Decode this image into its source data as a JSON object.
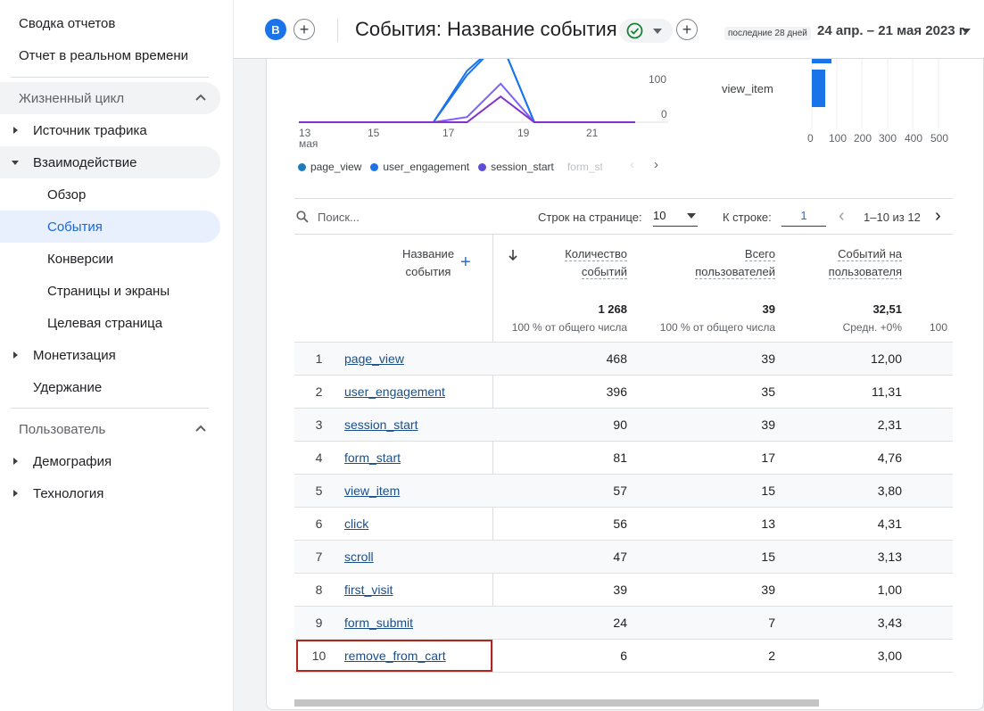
{
  "sidebar": {
    "top_links": [
      "Сводка отчетов",
      "Отчет в реальном времени"
    ],
    "sections": [
      {
        "label": "Жизненный цикл",
        "items": [
          {
            "label": "Источник трафика",
            "expandable": true,
            "expanded": false
          },
          {
            "label": "Взаимодействие",
            "expandable": true,
            "expanded": true
          },
          {
            "label": "Обзор",
            "sub": true
          },
          {
            "label": "События",
            "sub": true,
            "active": true
          },
          {
            "label": "Конверсии",
            "sub": true
          },
          {
            "label": "Страницы и экраны",
            "sub": true
          },
          {
            "label": "Целевая страница",
            "sub": true
          },
          {
            "label": "Монетизация",
            "expandable": true,
            "expanded": false
          },
          {
            "label": "Удержание",
            "expandable": false
          }
        ]
      },
      {
        "label": "Пользователь",
        "items": [
          {
            "label": "Демография",
            "expandable": true,
            "expanded": false
          },
          {
            "label": "Технология",
            "expandable": true,
            "expanded": false
          }
        ]
      }
    ]
  },
  "header": {
    "avatar_letter": "B",
    "title": "События: Название события",
    "date_label": "последние 28 дней",
    "date_range": "24 апр. – 21 мая 2023 г."
  },
  "chart_data": [
    {
      "type": "line",
      "x_ticks": [
        "13\nмая",
        "15",
        "17",
        "19",
        "21"
      ],
      "x_tick_labels": [
        "13",
        "15",
        "17",
        "19",
        "21"
      ],
      "x_tick_sublabel": "мая",
      "y_ticks": [
        "100",
        "0"
      ],
      "series": [
        {
          "name": "page_view",
          "color": "#1a73e8",
          "values": [
            0,
            0,
            0,
            0,
            0,
            120,
            340,
            0,
            0,
            0,
            0
          ]
        },
        {
          "name": "user_engagement",
          "color": "#1a73e8",
          "values": [
            0,
            0,
            0,
            0,
            0,
            110,
            310,
            0,
            0,
            0,
            0
          ]
        },
        {
          "name": "session_start",
          "color": "#7b61ff",
          "values": [
            0,
            0,
            0,
            0,
            0,
            12,
            90,
            0,
            0,
            0,
            0
          ]
        },
        {
          "name": "form_start",
          "color": "#8430ce",
          "values": [
            0,
            0,
            0,
            0,
            0,
            0,
            60,
            0,
            0,
            0,
            0
          ]
        }
      ]
    },
    {
      "type": "bar",
      "categories": [
        "view_item"
      ],
      "x_ticks": [
        "0",
        "100",
        "200",
        "300",
        "400",
        "500"
      ]
    }
  ],
  "legend": {
    "items": [
      {
        "label": "page_view",
        "color": "#1e7bbd"
      },
      {
        "label": "user_engagement",
        "color": "#1a73e8"
      },
      {
        "label": "session_start",
        "color": "#5b4fd6"
      },
      {
        "label": "form_st",
        "color": "#8430ce"
      }
    ]
  },
  "toolbar": {
    "search_placeholder": "Поиск...",
    "rows_per_page_label": "Строк на странице:",
    "rows_per_page_value": "10",
    "goto_label": "К строке:",
    "goto_value": "1",
    "pagination": "1–10 из 12"
  },
  "table": {
    "headers": {
      "name_line1": "Название",
      "name_line2": "события",
      "c1_line1": "Количество",
      "c1_line2": "событий",
      "c2_line1": "Всего",
      "c2_line2": "пользователей",
      "c3_line1": "Событий на",
      "c3_line2": "пользователя"
    },
    "totals": {
      "c1": "1 268",
      "c1_sub": "100 % от общего числа",
      "c2": "39",
      "c2_sub": "100 % от общего числа",
      "c3": "32,51",
      "c3_sub": "Средн. +0%",
      "c4_sub": "100"
    },
    "rows": [
      {
        "n": "1",
        "event": "page_view",
        "c1": "468",
        "c2": "39",
        "c3": "12,00"
      },
      {
        "n": "2",
        "event": "user_engagement",
        "c1": "396",
        "c2": "35",
        "c3": "11,31"
      },
      {
        "n": "3",
        "event": "session_start",
        "c1": "90",
        "c2": "39",
        "c3": "2,31"
      },
      {
        "n": "4",
        "event": "form_start",
        "c1": "81",
        "c2": "17",
        "c3": "4,76"
      },
      {
        "n": "5",
        "event": "view_item",
        "c1": "57",
        "c2": "15",
        "c3": "3,80"
      },
      {
        "n": "6",
        "event": "click",
        "c1": "56",
        "c2": "13",
        "c3": "4,31"
      },
      {
        "n": "7",
        "event": "scroll",
        "c1": "47",
        "c2": "15",
        "c3": "3,13"
      },
      {
        "n": "8",
        "event": "first_visit",
        "c1": "39",
        "c2": "39",
        "c3": "1,00"
      },
      {
        "n": "9",
        "event": "form_submit",
        "c1": "24",
        "c2": "7",
        "c3": "3,43"
      },
      {
        "n": "10",
        "event": "remove_from_cart",
        "c1": "6",
        "c2": "2",
        "c3": "3,00"
      }
    ]
  },
  "colors": {
    "accent": "#1a73e8",
    "highlight_outline": "#b3261e",
    "link": "#1a4f8b",
    "status_ok": "#188038"
  }
}
